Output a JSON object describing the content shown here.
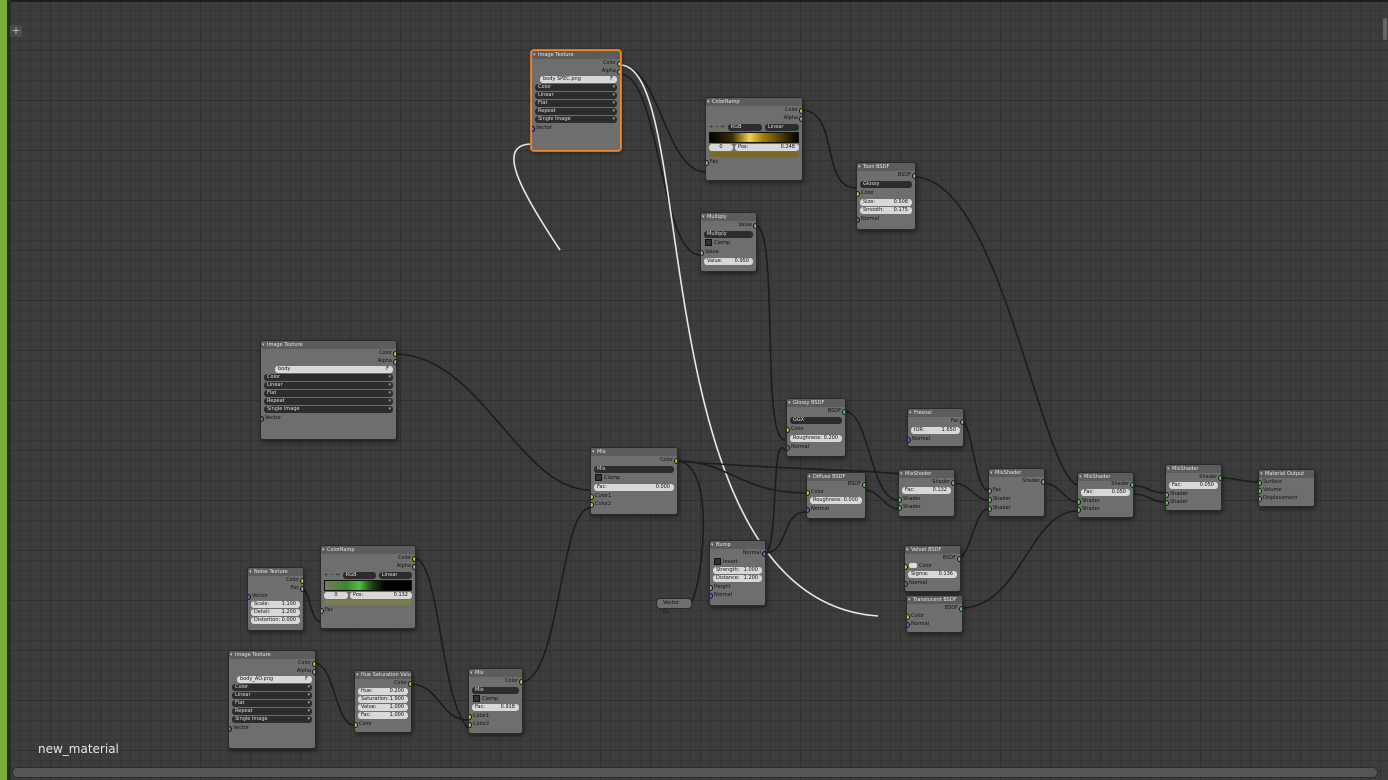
{
  "editor": {
    "material_name": "new_material",
    "add_button": "+"
  },
  "nodes": {
    "imgtex_top": {
      "title": "Image Texture",
      "out_color": "Color",
      "out_alpha": "Alpha",
      "image": "body SPEC.png",
      "f_btn": "F",
      "color": "Color",
      "interp": "Linear",
      "proj": "Flat",
      "ext": "Repeat",
      "source": "Single Image",
      "in_vector": "Vector"
    },
    "colorramp_top": {
      "title": "ColorRamp",
      "out_color": "Color",
      "out_alpha": "Alpha",
      "btns": "+  −  ↔",
      "mode": "RGB",
      "interp": "Linear",
      "index": "0",
      "pos_label": "Pos:",
      "pos": "0.248",
      "in_fac": "Fac"
    },
    "multiply": {
      "title": "Multiply",
      "out_value": "Value",
      "op": "Multiply",
      "clamp": "Clamp",
      "in_value": "Value",
      "value_label": "Value:",
      "value": "0.950"
    },
    "toon": {
      "title": "Toon BSDF",
      "out_bsdf": "BSDF",
      "comp": "Glossy",
      "color": "Color",
      "size_label": "Size:",
      "size": "0.508",
      "smooth_label": "Smooth:",
      "smooth": "0.175",
      "normal": "Normal"
    },
    "imgtex_mid": {
      "title": "Image Texture",
      "out_color": "Color",
      "out_alpha": "Alpha",
      "image": "body",
      "f_btn": "F",
      "color": "Color",
      "interp": "Linear",
      "proj": "Flat",
      "ext": "Repeat",
      "source": "Single Image",
      "in_vector": "Vector"
    },
    "glossy": {
      "title": "Glossy BSDF",
      "out_bsdf": "BSDF",
      "dist": "GGX",
      "color": "Color",
      "rough_label": "Roughness:",
      "rough": "0.200",
      "normal": "Normal"
    },
    "fresnel": {
      "title": "Fresnel",
      "out_fac": "Fac",
      "ior_label": "IOR:",
      "ior": "1.650",
      "normal": "Normal"
    },
    "mix_mid": {
      "title": "Mix",
      "out_color": "Color",
      "mode": "Mix",
      "clamp": "Clamp",
      "fac_label": "Fac:",
      "fac": "0.000",
      "color1": "Color1",
      "color2": "Color2"
    },
    "diffuse": {
      "title": "Diffuse BSDF",
      "out_bsdf": "BSDF",
      "color": "Color",
      "rough_label": "Roughness:",
      "rough": "0.000",
      "normal": "Normal"
    },
    "mixshader1": {
      "title": "MixShader",
      "out": "Shader",
      "fac_label": "Fac:",
      "fac": "0.132",
      "sh1": "Shader",
      "sh2": "Shader"
    },
    "mixshader2": {
      "title": "MixShader",
      "out": "Shader",
      "fac": "Fac",
      "sh1": "Shader",
      "sh2": "Shader"
    },
    "mixshader3": {
      "title": "MixShader",
      "out": "Shader",
      "fac_label": "Fac:",
      "fac": "0.050",
      "sh1": "Shader",
      "sh2": "Shader"
    },
    "mixshader4": {
      "title": "MixShader",
      "out": "Shader",
      "fac_label": "Fac:",
      "fac": "0.050",
      "sh1": "Shader",
      "sh2": "Shader"
    },
    "output": {
      "title": "Material Output",
      "surface": "Surface",
      "volume": "Volume",
      "disp": "Displacement"
    },
    "noise": {
      "title": "Noise Texture",
      "out_color": "Color",
      "out_fac": "Fac",
      "in_vector": "Vector",
      "scale_label": "Scale:",
      "scale": "1.100",
      "detail_label": "Detail:",
      "detail": "1.200",
      "dist_label": "Distortion:",
      "dist": "0.000"
    },
    "colorramp_bot": {
      "title": "ColorRamp",
      "out_color": "Color",
      "out_alpha": "Alpha",
      "btns": "+  −  ↔",
      "mode": "RGB",
      "interp": "Linear",
      "index": "0",
      "pos_label": "Pos:",
      "pos": "0.132",
      "in_fac": "Fac"
    },
    "bump": {
      "title": "Bump",
      "out_normal": "Normal",
      "invert": "Invert",
      "str_label": "Strength:",
      "str": "1.000",
      "dist_label": "Distance:",
      "dist": "1.200",
      "height": "Height",
      "normal": "Normal"
    },
    "reroute_vec": {
      "label": "Vector (Li"
    },
    "velvet": {
      "title": "Velvet BSDF",
      "out_bsdf": "BSDF",
      "color": "Color",
      "sigma_label": "Sigma:",
      "sigma": "0.136",
      "normal": "Normal"
    },
    "translucent": {
      "title": "Translucent BSDF",
      "out_bsdf": "BSDF",
      "color": "Color",
      "normal": "Normal"
    },
    "imgtex_bot": {
      "title": "Image Texture",
      "out_color": "Color",
      "out_alpha": "Alpha",
      "image": "body_AO.png",
      "f_btn": "F",
      "color": "Color",
      "interp": "Linear",
      "proj": "Flat",
      "ext": "Repeat",
      "source": "Single Image",
      "in_vector": "Vector"
    },
    "hsv": {
      "title": "Hue Saturation Value",
      "out_color": "Color",
      "hue_label": "Hue:",
      "hue": "0.200",
      "sat_label": "Saturation:",
      "sat": "1.900",
      "val_label": "Value:",
      "val": "1.000",
      "fac_label": "Fac:",
      "fac": "1.000",
      "color": "Color"
    },
    "mix_bot": {
      "title": "Mix",
      "out_color": "Color",
      "mode": "Mix",
      "clamp": "Clamp",
      "fac_label": "Fac:",
      "fac": "0.918",
      "color1": "Color1",
      "color2": "Color2"
    }
  },
  "colors": {
    "active_border": "#f08a2c",
    "socket_color": "#c7c729",
    "socket_value": "#a1a1a1",
    "socket_vector": "#6363c7",
    "socket_shader": "#63c763",
    "grid_bg": "#3c3c3c",
    "left_edge": "#78b038"
  }
}
